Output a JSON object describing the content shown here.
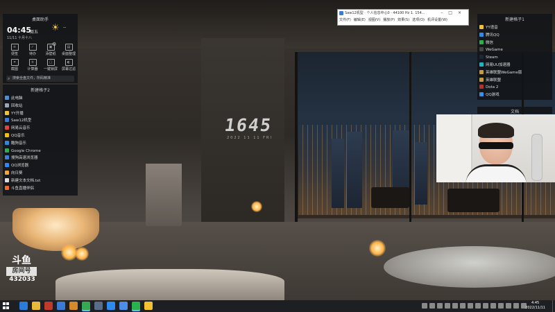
{
  "wallpaper": {
    "clock_text": "1645",
    "clock_sub": "2022 11 11 FRI"
  },
  "left_widget": {
    "title": "桌面助手",
    "time": "04:45",
    "weekday": "周五",
    "date": "11/11 十月十八",
    "weather_value": "--",
    "tools": [
      {
        "label": "便签",
        "icon": "note-icon"
      },
      {
        "label": "待办",
        "icon": "todo-icon"
      },
      {
        "label": "添壁纸",
        "icon": "wallpaper-icon"
      },
      {
        "label": "桌面整理",
        "icon": "organize-icon"
      },
      {
        "label": "截图",
        "icon": "screenshot-icon"
      },
      {
        "label": "计算器",
        "icon": "calculator-icon"
      },
      {
        "label": "一键锁屏",
        "icon": "lock-icon"
      },
      {
        "label": "屏幕过滤",
        "icon": "filter-icon"
      }
    ],
    "search_placeholder": "搜索全盘文件，所码精准"
  },
  "left_list": {
    "title": "新建格子2",
    "items": [
      {
        "label": "此电脑",
        "color": "#4a90d9"
      },
      {
        "label": "回收站",
        "color": "#9aa7b5"
      },
      {
        "label": "YY开播",
        "color": "#f2c230"
      },
      {
        "label": "Saw12机型",
        "color": "#3a7bd5"
      },
      {
        "label": "网易云音乐",
        "color": "#e0453a"
      },
      {
        "label": "QQ音乐",
        "color": "#f4c000"
      },
      {
        "label": "酷狗音乐",
        "color": "#2e88e0"
      },
      {
        "label": "Google Chrome",
        "color": "#35a853"
      },
      {
        "label": "搜狗高速浏览器",
        "color": "#3f7ed6"
      },
      {
        "label": "QQ浏览器",
        "color": "#2d8bf0"
      },
      {
        "label": "向日葵",
        "color": "#f3a43b"
      },
      {
        "label": "新建文本文档.txt",
        "color": "#dcdcdc"
      },
      {
        "label": "斗鱼直播伴侣",
        "color": "#f26a2a"
      }
    ]
  },
  "right_panel": {
    "title": "新建格子1",
    "items": [
      {
        "label": "YY语音",
        "color": "#f2c230"
      },
      {
        "label": "腾讯QQ",
        "color": "#2d8bf0"
      },
      {
        "label": "微信",
        "color": "#2ab24f"
      },
      {
        "label": "WeGame",
        "color": "#444444"
      },
      {
        "label": "Steam",
        "color": "#1b2838"
      },
      {
        "label": "网易UU加速器",
        "color": "#19b6c4"
      },
      {
        "label": "英雄联盟WeGame版",
        "color": "#c69b3a"
      },
      {
        "label": "英雄联盟",
        "color": "#c69b3a"
      },
      {
        "label": "Dota 2",
        "color": "#b3332b"
      },
      {
        "label": "QQ游戏",
        "color": "#3b8ee8"
      }
    ],
    "doc_title": "文档"
  },
  "app_window": {
    "title": "Saw12机型 · 个人信息中心0 · 44100 Hz 1. 154...",
    "menus": [
      "文件(F)",
      "编辑(E)",
      "视图(V)",
      "播放(P)",
      "效果(S)",
      "选项(O)",
      "机评设置(W)"
    ],
    "controls": [
      "–",
      "□",
      "×"
    ]
  },
  "douyu": {
    "logo_line1": "斗鱼",
    "logo_line2": "房间号",
    "room_id": "432033"
  },
  "taskbar": {
    "time": "4:45",
    "date": "2022/11/11",
    "apps": [
      {
        "name": "edge-icon",
        "color": "#2b7bd9",
        "active": false
      },
      {
        "name": "explorer-icon",
        "color": "#e7b83a",
        "active": false
      },
      {
        "name": "app-icon-3",
        "color": "#c03a2b",
        "active": false
      },
      {
        "name": "saw-icon",
        "color": "#3a7bd5",
        "active": false
      },
      {
        "name": "box-icon",
        "color": "#d48a2a",
        "active": false
      },
      {
        "name": "chrome-icon",
        "color": "#35a853",
        "active": true
      },
      {
        "name": "steam-icon",
        "color": "#5a6d88",
        "active": false
      },
      {
        "name": "qq-browser-icon",
        "color": "#2d8bf0",
        "active": false
      },
      {
        "name": "chat-icon",
        "color": "#4c8de8",
        "active": false
      },
      {
        "name": "wechat-icon",
        "color": "#2ab24f",
        "active": true
      },
      {
        "name": "yy-icon",
        "color": "#f2c230",
        "active": false
      }
    ]
  }
}
